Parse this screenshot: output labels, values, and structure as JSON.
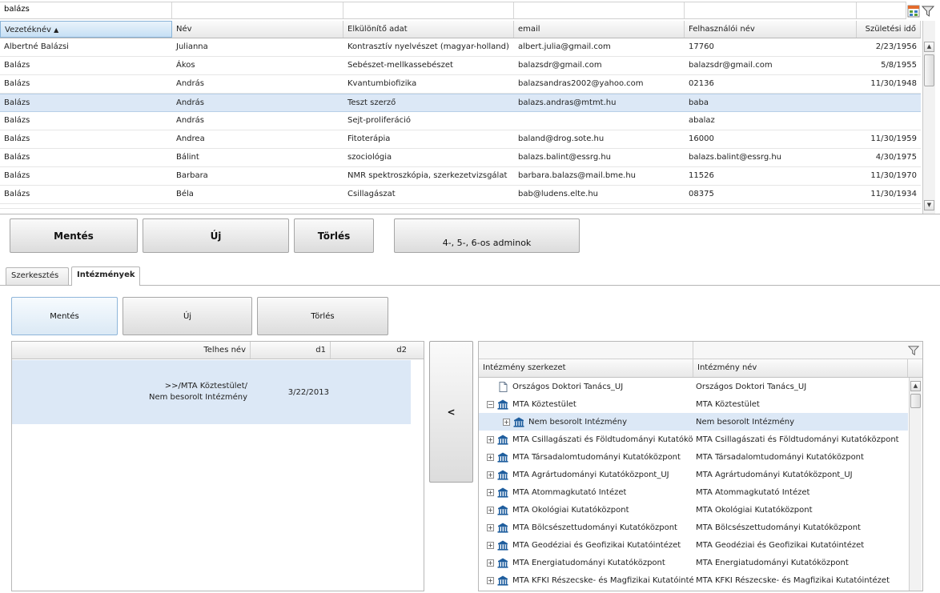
{
  "top_grid": {
    "filter_value": "balázs",
    "columns": [
      "Vezetéknév",
      "Név",
      "Elkülönítő adat",
      "email",
      "Felhasználói név",
      "Születési idő"
    ],
    "sort_indicator": "▲",
    "rows": [
      [
        "Albertné Balázsi",
        "Julianna",
        "Kontrasztív nyelvészet (magyar-holland)",
        "albert.julia@gmail.com",
        "17760",
        "2/23/1956"
      ],
      [
        "Balázs",
        "Ákos",
        "Sebészet-mellkassebészet",
        "balazsdr@gmail.com",
        "balazsdr@gmail.com",
        "5/8/1955"
      ],
      [
        "Balázs",
        "András",
        "Kvantumbiofizika",
        "balazsandras2002@yahoo.com",
        "02136",
        "11/30/1948"
      ],
      [
        "Balázs",
        "András",
        "Teszt szerző",
        "balazs.andras@mtmt.hu",
        "baba",
        ""
      ],
      [
        "Balázs",
        "András",
        "Sejt-proliferáció",
        "",
        "abalaz",
        ""
      ],
      [
        "Balázs",
        "Andrea",
        "Fitoterápia",
        "baland@drog.sote.hu",
        "16000",
        "11/30/1959"
      ],
      [
        "Balázs",
        "Bálint",
        "szociológia",
        "balazs.balint@essrg.hu",
        "balazs.balint@essrg.hu",
        "4/30/1975"
      ],
      [
        "Balázs",
        "Barbara",
        "NMR spektroszkópia, szerkezetvizsgálat",
        "barbara.balazs@mail.bme.hu",
        "11526",
        "11/30/1970"
      ],
      [
        "Balázs",
        "Béla",
        "Csillagászat",
        "bab@ludens.elte.hu",
        "08375",
        "11/30/1934"
      ]
    ],
    "selected_row": 3
  },
  "main_buttons": {
    "save": "Mentés",
    "new": "Új",
    "delete": "Törlés",
    "admins": "4-, 5-, 6-os adminok"
  },
  "tabs": [
    {
      "label": "Szerkesztés",
      "active": false
    },
    {
      "label": "Intézmények",
      "active": true
    }
  ],
  "sub_buttons": {
    "save": "Mentés",
    "new": "Új",
    "delete": "Törlés"
  },
  "assigned_table": {
    "columns": [
      "Telhes név",
      "d1",
      "d2"
    ],
    "rows": [
      {
        "name_line1": ">>/MTA Köztestület/",
        "name_line2": "Nem besorolt Intézmény",
        "d1": "3/22/2013",
        "d2": ""
      }
    ]
  },
  "move_button": "<",
  "tree": {
    "columns": [
      "Intézmény szerkezet",
      "Intézmény név"
    ],
    "rows": [
      {
        "struct": "Országos Doktori Tanács_ÚJ",
        "name": "Országos Doktori Tanács_ÚJ",
        "icon": "document-icon",
        "level": 0,
        "expander": ""
      },
      {
        "struct": "MTA Köztestület",
        "name": "MTA Köztestület",
        "icon": "institution-icon",
        "level": 0,
        "expander": "−"
      },
      {
        "struct": "Nem besorolt Intézmény",
        "name": "Nem besorolt Intézmény",
        "icon": "institution-icon",
        "level": 1,
        "expander": "+",
        "selected": true
      },
      {
        "struct": "MTA Csillagászati és Földtudományi Kutatóközpont",
        "name": "MTA Csillagászati és Földtudományi Kutatóközpont",
        "icon": "institution-icon",
        "level": 0,
        "expander": "+"
      },
      {
        "struct": "MTA Társadalomtudományi Kutatóközpont",
        "name": "MTA Társadalomtudományi Kutatóközpont",
        "icon": "institution-icon",
        "level": 0,
        "expander": "+"
      },
      {
        "struct": "MTA Agrártudományi Kutatóközpont_ÚJ",
        "name": "MTA Agrártudományi Kutatóközpont_ÚJ",
        "icon": "institution-icon",
        "level": 0,
        "expander": "+"
      },
      {
        "struct": "MTA Atommagkutató Intézet",
        "name": "MTA Atommagkutató Intézet",
        "icon": "institution-icon",
        "level": 0,
        "expander": "+"
      },
      {
        "struct": "MTA Ökológiai Kutatóközpont",
        "name": "MTA Ökológiai Kutatóközpont",
        "icon": "institution-icon",
        "level": 0,
        "expander": "+"
      },
      {
        "struct": "MTA Bölcsészettudományi Kutatóközpont",
        "name": "MTA Bölcsészettudományi Kutatóközpont",
        "icon": "institution-icon",
        "level": 0,
        "expander": "+"
      },
      {
        "struct": "MTA Geodéziai és Geofizikai Kutatóintézet",
        "name": "MTA Geodéziai és Geofizikai Kutatóintézet",
        "icon": "institution-icon",
        "level": 0,
        "expander": "+"
      },
      {
        "struct": "MTA Energiatudományi Kutatóközpont",
        "name": "MTA Energiatudományi Kutatóközpont",
        "icon": "institution-icon",
        "level": 0,
        "expander": "+"
      },
      {
        "struct": "MTA KFKI Részecske- és Magfizikai Kutatóintézet",
        "name": "MTA KFKI Részecske- és Magfizikai Kutatóintézet",
        "icon": "institution-icon",
        "level": 0,
        "expander": "+"
      }
    ]
  },
  "icons": {
    "column_chooser": "grid-settings-icon",
    "filter": "filter-icon"
  },
  "colors": {
    "selection": "#dce8f6",
    "institution_icon": "#1f5e9e"
  }
}
